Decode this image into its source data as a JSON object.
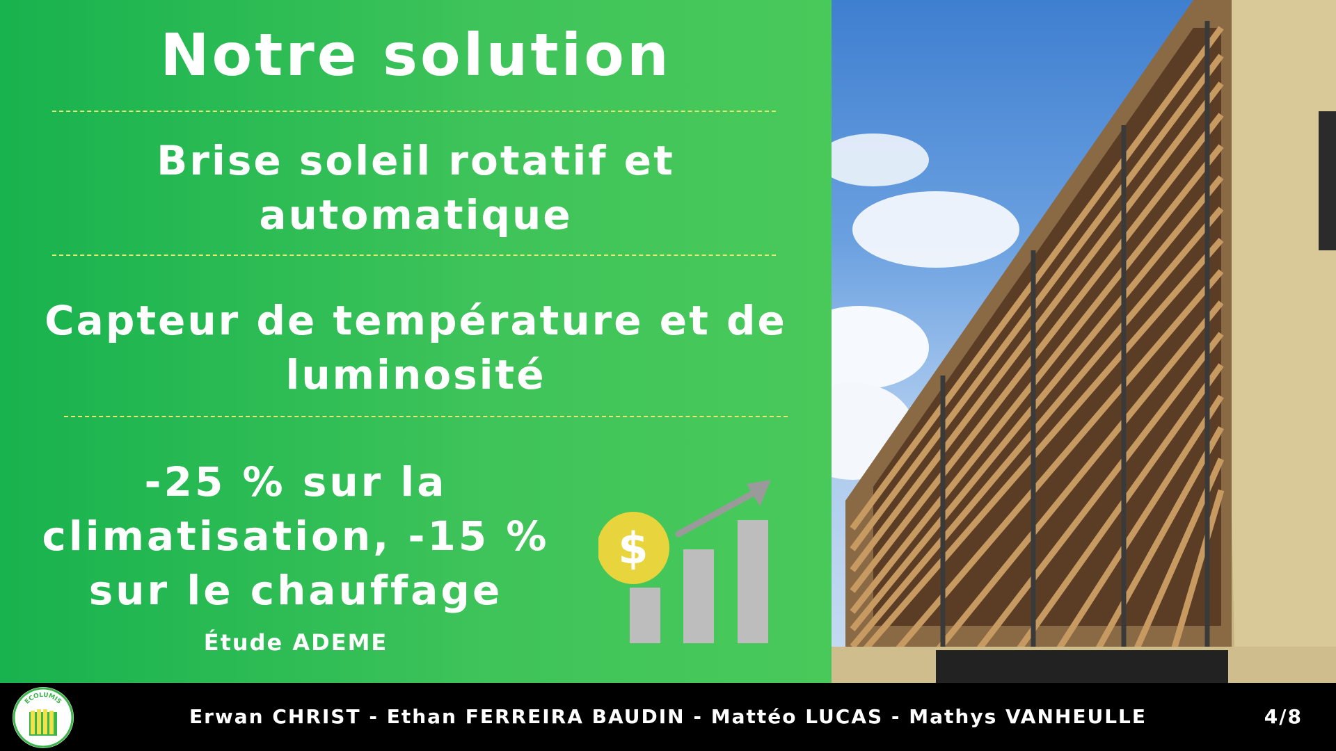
{
  "slide": {
    "title": "Notre solution",
    "point1": [
      "Brise soleil rotatif et",
      "automatique"
    ],
    "point2": [
      "Capteur de température et de",
      "luminosité"
    ],
    "stat": [
      "-25 % sur la",
      "climatisation, -15 %",
      "sur le chauffage"
    ],
    "source": "Étude ADEME",
    "icon_symbol": "$"
  },
  "footer": {
    "logo_text": "ECOLUMIS",
    "authors": "Erwan CHRIST - Ethan FERREIRA BAUDIN - Mattéo LUCAS - Mathys VANHEULLE",
    "page": "4/8"
  },
  "colors": {
    "green_start": "#18b24e",
    "green_end": "#49c95a",
    "separator": "#e6e870",
    "coin": "#e8d43c",
    "bars": "#bdbdbd"
  },
  "icons": [
    "money-growth-icon",
    "ecolumis-logo",
    "building-photo"
  ]
}
